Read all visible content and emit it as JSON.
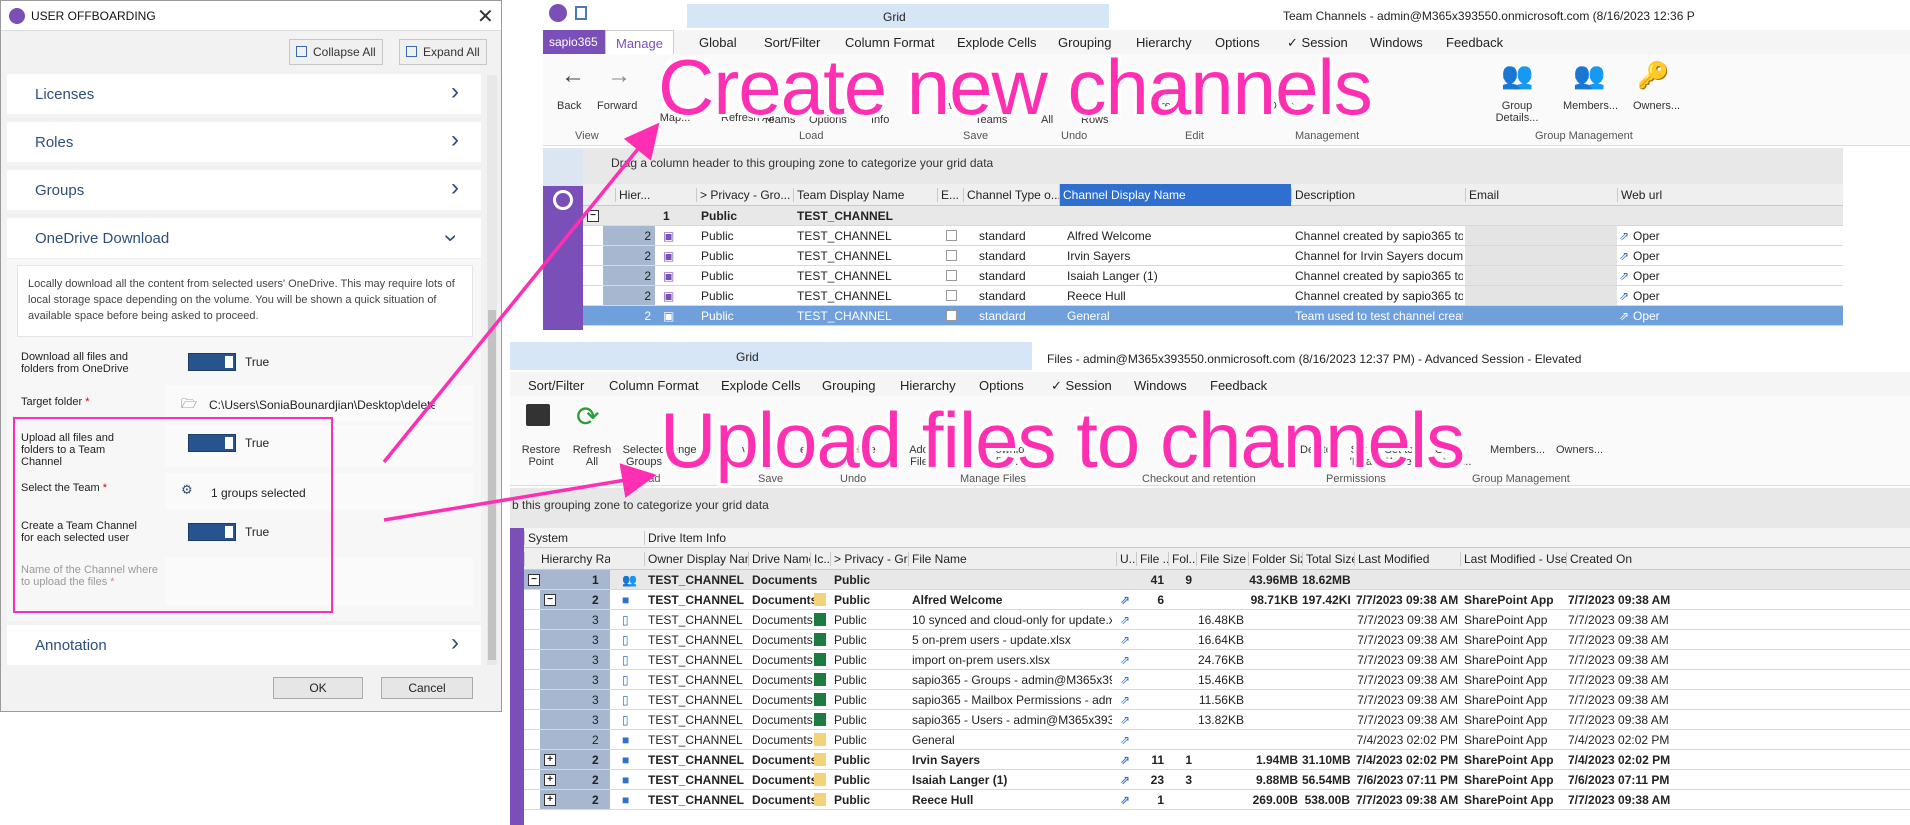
{
  "dialog": {
    "title": "USER OFFBOARDING",
    "collapse_all": "Collapse All",
    "expand_all": "Expand All",
    "sections": {
      "licenses": "Licenses",
      "roles": "Roles",
      "groups": "Groups",
      "onedrive": "OneDrive Download",
      "annotation": "Annotation"
    },
    "description": "Locally download all the content from selected users' OneDrive. This may require lots of local storage space depending on the volume. You will be shown a quick situation of available space before being asked to proceed.",
    "fields": {
      "download_label": "Download all files and folders from OneDrive",
      "download_value": "True",
      "target_label": "Target folder",
      "target_value": "C:\\Users\\SoniaBounardjian\\Desktop\\delete",
      "upload_label": "Upload all files and folders to a Team Channel",
      "upload_value": "True",
      "team_label": "Select the Team",
      "team_value": "1 groups selected",
      "create_label": "Create a Team Channel for each selected user",
      "create_value": "True",
      "channel_name_label": "Name of the Channel where to upload the files",
      "required": "*"
    },
    "ok": "OK",
    "cancel": "Cancel"
  },
  "top_window": {
    "grid_tab": "Grid",
    "title": "Team Channels - admin@M365x393550.onmicrosoft.com (8/16/2023 12:36 P",
    "tabs": [
      "sapio365",
      "Manage",
      "Global",
      "Sort/Filter",
      "Column Format",
      "Explode Cells",
      "Grouping",
      "Hierarchy",
      "Options",
      "Session",
      "Windows",
      "Feedback"
    ],
    "check_mark": "✓",
    "buttons": {
      "back": "Back",
      "forward": "Forward",
      "column_map": "Co... Map...",
      "refresh": "Refresh All",
      "teams": "Teams",
      "options": "Options",
      "info": "Info",
      "save": "Sav...",
      "save_teams": "Teams",
      "undo_all": "All",
      "undo_rows": "Rows",
      "edit_create": "Crea",
      "mgmt": "Desc...",
      "group_details": "Group Details...",
      "members": "Members...",
      "owners": "Owners..."
    },
    "groups": {
      "view": "View",
      "load": "Load",
      "save": "Save",
      "undo": "Undo",
      "edit": "Edit",
      "management": "Management",
      "group_management": "Group Management"
    },
    "grouping_zone": "Drag a column header to this grouping zone to categorize your grid data",
    "columns": [
      "Hier...",
      "> Privacy - Gro...",
      "Team Display Name",
      "E...",
      "Channel Type o...",
      "Channel Display Name",
      "Description",
      "Email",
      "Web url"
    ],
    "group_row": {
      "num": "1",
      "privacy": "Public",
      "team": "TEST_CHANNEL"
    },
    "rows": [
      {
        "num": "2",
        "privacy": "Public",
        "team": "TEST_CHANNEL",
        "type": "standard",
        "name": "Alfred Welcome",
        "desc": "Channel created by sapio365 to h",
        "web": "Oper"
      },
      {
        "num": "2",
        "privacy": "Public",
        "team": "TEST_CHANNEL",
        "type": "standard",
        "name": "Irvin Sayers",
        "desc": "Channel for Irvin Sayers docume",
        "web": "Oper"
      },
      {
        "num": "2",
        "privacy": "Public",
        "team": "TEST_CHANNEL",
        "type": "standard",
        "name": "Isaiah Langer (1)",
        "desc": "Channel created by sapio365 to h",
        "web": "Oper"
      },
      {
        "num": "2",
        "privacy": "Public",
        "team": "TEST_CHANNEL",
        "type": "standard",
        "name": "Reece Hull",
        "desc": "Channel created by sapio365 to h",
        "web": "Oper"
      },
      {
        "num": "2",
        "privacy": "Public",
        "team": "TEST_CHANNEL",
        "type": "standard",
        "name": "General",
        "desc": "Team used to test channel creatio",
        "web": "Oper"
      }
    ]
  },
  "bottom_window": {
    "grid_tab": "Grid",
    "title": "Files - admin@M365x393550.onmicrosoft.com (8/16/2023 12:37 PM) - Advanced Session - Elevated",
    "tabs": [
      "Sort/Filter",
      "Column Format",
      "Explode Cells",
      "Grouping",
      "Hierarchy",
      "Options",
      "Session",
      "Windows",
      "Feedback"
    ],
    "buttons": {
      "restore": "Restore Point",
      "refresh": "Refresh All",
      "selected_groups": "Selected Groups",
      "change": "ange",
      "ve": "ve",
      "ed": "ed",
      "delete": "Delete",
      "add_file": "Add File",
      "downlo": "ownlo files...",
      "delete2": "Delete",
      "set_read": "Set to 'Read'",
      "set_write": "Set to 'Write'",
      "group_details": "Group Details...",
      "members": "Members...",
      "owners": "Owners..."
    },
    "groups": {
      "load": "Load",
      "save": "Save",
      "undo": "Undo",
      "manage_files": "Manage Files",
      "checkout": "Checkout and retention",
      "permissions": "Permissions",
      "group_management": "Group Management"
    },
    "grouping_zone": "b this grouping zone to categorize your grid data",
    "bands": {
      "system": "System",
      "drive_item": "Drive Item Info"
    },
    "columns": [
      "Hierarchy Ra...",
      "Owner Display Name",
      "Drive Name",
      "Ic...",
      "> Privacy - Gro...",
      "File Name",
      "U...",
      "File ...",
      "Fol...",
      "File Size",
      "Folder Size",
      "Total Size",
      "Last Modified",
      "Last Modified - Usern...",
      "Created On"
    ],
    "rows": [
      {
        "exp": "−",
        "num": "1",
        "owner": "TEST_CHANNEL",
        "drive": "Documents",
        "privacy": "Public",
        "file": "",
        "fc": "41",
        "fol": "9",
        "fsize": "",
        "folsize": "43.96MB",
        "total": "18.62MB",
        "mod": "",
        "user": "",
        "created": "",
        "bold": true,
        "kind": "group"
      },
      {
        "exp": "−",
        "num": "2",
        "owner": "TEST_CHANNEL",
        "drive": "Documents",
        "privacy": "Public",
        "file": "Alfred Welcome",
        "fc": "6",
        "fol": "",
        "fsize": "",
        "folsize": "98.71KB",
        "total": "197.42KB",
        "mod": "7/7/2023 09:38 AM",
        "user": "SharePoint App",
        "created": "7/7/2023 09:38 AM",
        "bold": true,
        "kind": "folder"
      },
      {
        "exp": "",
        "num": "3",
        "owner": "TEST_CHANNEL",
        "drive": "Documents",
        "privacy": "Public",
        "file": "10 synced and cloud-only for update.xlsx",
        "fc": "",
        "fol": "",
        "fsize": "16.48KB",
        "folsize": "",
        "total": "",
        "mod": "7/7/2023 09:38 AM",
        "user": "SharePoint App",
        "created": "7/7/2023 09:38 AM",
        "bold": false,
        "kind": "file"
      },
      {
        "exp": "",
        "num": "3",
        "owner": "TEST_CHANNEL",
        "drive": "Documents",
        "privacy": "Public",
        "file": "5 on-prem users - update.xlsx",
        "fc": "",
        "fol": "",
        "fsize": "16.64KB",
        "folsize": "",
        "total": "",
        "mod": "7/7/2023 09:38 AM",
        "user": "SharePoint App",
        "created": "7/7/2023 09:38 AM",
        "bold": false,
        "kind": "file"
      },
      {
        "exp": "",
        "num": "3",
        "owner": "TEST_CHANNEL",
        "drive": "Documents",
        "privacy": "Public",
        "file": "import on-prem users.xlsx",
        "fc": "",
        "fol": "",
        "fsize": "24.76KB",
        "folsize": "",
        "total": "",
        "mod": "7/7/2023 09:38 AM",
        "user": "SharePoint App",
        "created": "7/7/2023 09:38 AM",
        "bold": false,
        "kind": "file"
      },
      {
        "exp": "",
        "num": "3",
        "owner": "TEST_CHANNEL",
        "drive": "Documents",
        "privacy": "Public",
        "file": "sapio365 - Groups - admin@M365x393550.onm",
        "fc": "",
        "fol": "",
        "fsize": "15.46KB",
        "folsize": "",
        "total": "",
        "mod": "7/7/2023 09:38 AM",
        "user": "SharePoint App",
        "created": "7/7/2023 09:38 AM",
        "bold": false,
        "kind": "file"
      },
      {
        "exp": "",
        "num": "3",
        "owner": "TEST_CHANNEL",
        "drive": "Documents",
        "privacy": "Public",
        "file": "sapio365 - Mailbox Permissions - admin@M365",
        "fc": "",
        "fol": "",
        "fsize": "11.56KB",
        "folsize": "",
        "total": "",
        "mod": "7/7/2023 09:38 AM",
        "user": "SharePoint App",
        "created": "7/7/2023 09:38 AM",
        "bold": false,
        "kind": "file"
      },
      {
        "exp": "",
        "num": "3",
        "owner": "TEST_CHANNEL",
        "drive": "Documents",
        "privacy": "Public",
        "file": "sapio365 - Users - admin@M365x393550.onmicr",
        "fc": "",
        "fol": "",
        "fsize": "13.82KB",
        "folsize": "",
        "total": "",
        "mod": "7/7/2023 09:38 AM",
        "user": "SharePoint App",
        "created": "7/7/2023 09:38 AM",
        "bold": false,
        "kind": "file"
      },
      {
        "exp": "",
        "num": "2",
        "owner": "TEST_CHANNEL",
        "drive": "Documents",
        "privacy": "Public",
        "file": "General",
        "fc": "",
        "fol": "",
        "fsize": "",
        "folsize": "",
        "total": "",
        "mod": "7/4/2023 02:02 PM",
        "user": "SharePoint App",
        "created": "7/4/2023 02:02 PM",
        "bold": false,
        "kind": "folder"
      },
      {
        "exp": "+",
        "num": "2",
        "owner": "TEST_CHANNEL",
        "drive": "Documents",
        "privacy": "Public",
        "file": "Irvin Sayers",
        "fc": "11",
        "fol": "1",
        "fsize": "",
        "folsize": "1.94MB",
        "total": "31.10MB",
        "mod": "7/4/2023 02:02 PM",
        "user": "SharePoint App",
        "created": "7/4/2023 02:02 PM",
        "bold": true,
        "kind": "folder"
      },
      {
        "exp": "+",
        "num": "2",
        "owner": "TEST_CHANNEL",
        "drive": "Documents",
        "privacy": "Public",
        "file": "Isaiah Langer (1)",
        "fc": "23",
        "fol": "3",
        "fsize": "",
        "folsize": "9.88MB",
        "total": "56.54MB",
        "mod": "7/6/2023 07:11 PM",
        "user": "SharePoint App",
        "created": "7/6/2023 07:11 PM",
        "bold": true,
        "kind": "folder"
      },
      {
        "exp": "+",
        "num": "2",
        "owner": "TEST_CHANNEL",
        "drive": "Documents",
        "privacy": "Public",
        "file": "Reece Hull",
        "fc": "1",
        "fol": "",
        "fsize": "",
        "folsize": "269.00B",
        "total": "538.00B",
        "mod": "7/7/2023 09:38 AM",
        "user": "SharePoint App",
        "created": "7/7/2023 09:38 AM",
        "bold": true,
        "kind": "folder"
      }
    ]
  },
  "annotations": {
    "create_channels": "Create new channels",
    "upload_files": "Upload files to channels"
  },
  "colors": {
    "accent": "#7b4fb8",
    "annotation": "#ff2fb3",
    "selection": "#6fa0dc",
    "toggle": "#27548f"
  }
}
